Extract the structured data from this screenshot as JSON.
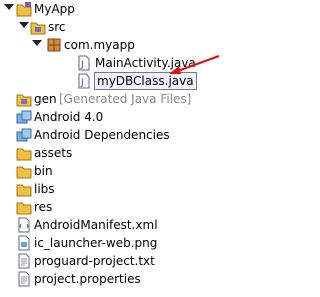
{
  "tree": {
    "root": "MyApp",
    "src": "src",
    "package": "com.myapp",
    "files_in_package": [
      "MainActivity.java",
      "myDBClass.java"
    ],
    "gen": "gen",
    "gen_note": "[Generated Java Files]",
    "android": "Android 4.0",
    "android_deps": "Android Dependencies",
    "folders": [
      "assets",
      "bin",
      "libs",
      "res"
    ],
    "files": [
      "AndroidManifest.xml",
      "ic_launcher-web.png",
      "proguard-project.txt",
      "project.properties"
    ]
  },
  "colors": {
    "arrow": "#e01010",
    "selection_border": "#6f7a9a"
  }
}
